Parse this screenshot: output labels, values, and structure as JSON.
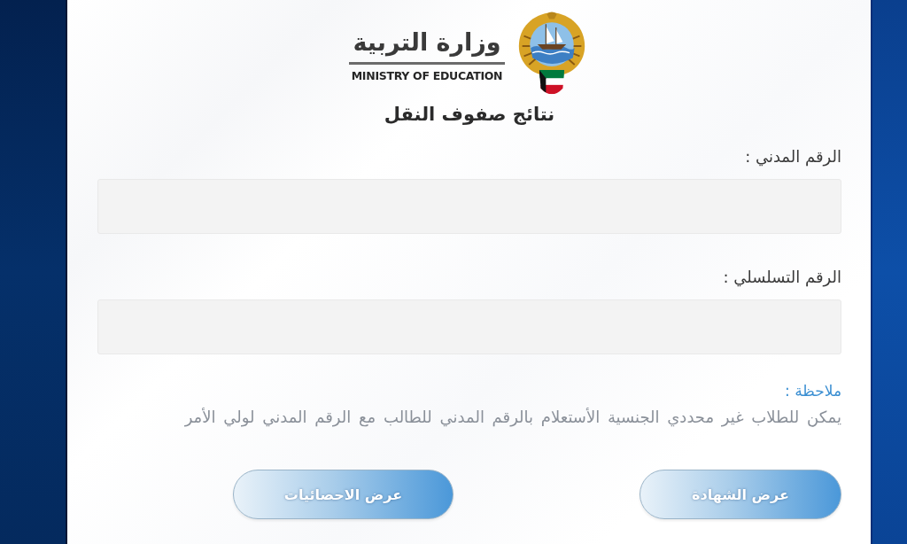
{
  "header": {
    "ministry_name_ar": "وزارة التربية",
    "ministry_name_en": "MINISTRY OF EDUCATION",
    "page_title": "نتائج صفوف النقل"
  },
  "form": {
    "fields": [
      {
        "label": "الرقم المدني :"
      },
      {
        "label": "الرقم التسلسلي :"
      }
    ]
  },
  "note": {
    "title": "ملاحظة :",
    "text": "يمكن للطلاب غير محددي الجنسية الأستعلام بالرقم المدني للطالب مع الرقم المدني لولي الأمر"
  },
  "buttons": [
    {
      "label": "عرض الشهادة"
    },
    {
      "label": "عرض الاحصائيات"
    }
  ]
}
